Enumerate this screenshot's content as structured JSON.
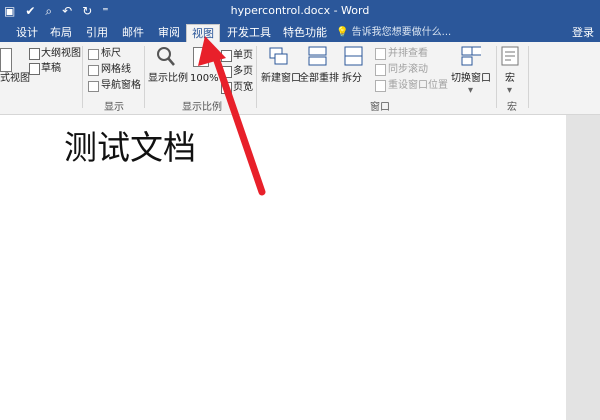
{
  "titlebar": {
    "title": "hypercontrol.docx - Word",
    "qat_icons": [
      "save-icon",
      "spellcheck-icon",
      "print-preview-icon",
      "undo-icon",
      "redo-icon",
      "customize-icon"
    ]
  },
  "tabs": [
    "设计",
    "布局",
    "引用",
    "邮件",
    "审阅",
    "视图",
    "开发工具",
    "特色功能"
  ],
  "active_tab": "视图",
  "tell_me": "告诉我您想要做什么...",
  "signin": "登录",
  "views_group": {
    "web_layout": "式视图",
    "outline": "大纲视图",
    "draft": "草稿"
  },
  "show_group": {
    "label": "显示",
    "items": [
      "标尺",
      "网格线",
      "导航窗格"
    ]
  },
  "zoom_group": {
    "label": "显示比例",
    "zoom": "显示比例",
    "hundred": "100%",
    "one_page": "单页",
    "multi_page": "多页",
    "page_width": "页宽"
  },
  "window_group": {
    "label": "窗口",
    "new_window": "新建窗口",
    "arrange_all": "全部重排",
    "split": "拆分",
    "side_by_side": "并排查看",
    "sync_scroll": "同步滚动",
    "reset_position": "重设窗口位置",
    "switch_windows": "切换窗口"
  },
  "macros_group": {
    "label": "宏",
    "macros": "宏"
  },
  "document": {
    "text": "测试文档"
  },
  "colors": {
    "brand": "#2b579a",
    "arrow": "#e8202a"
  }
}
